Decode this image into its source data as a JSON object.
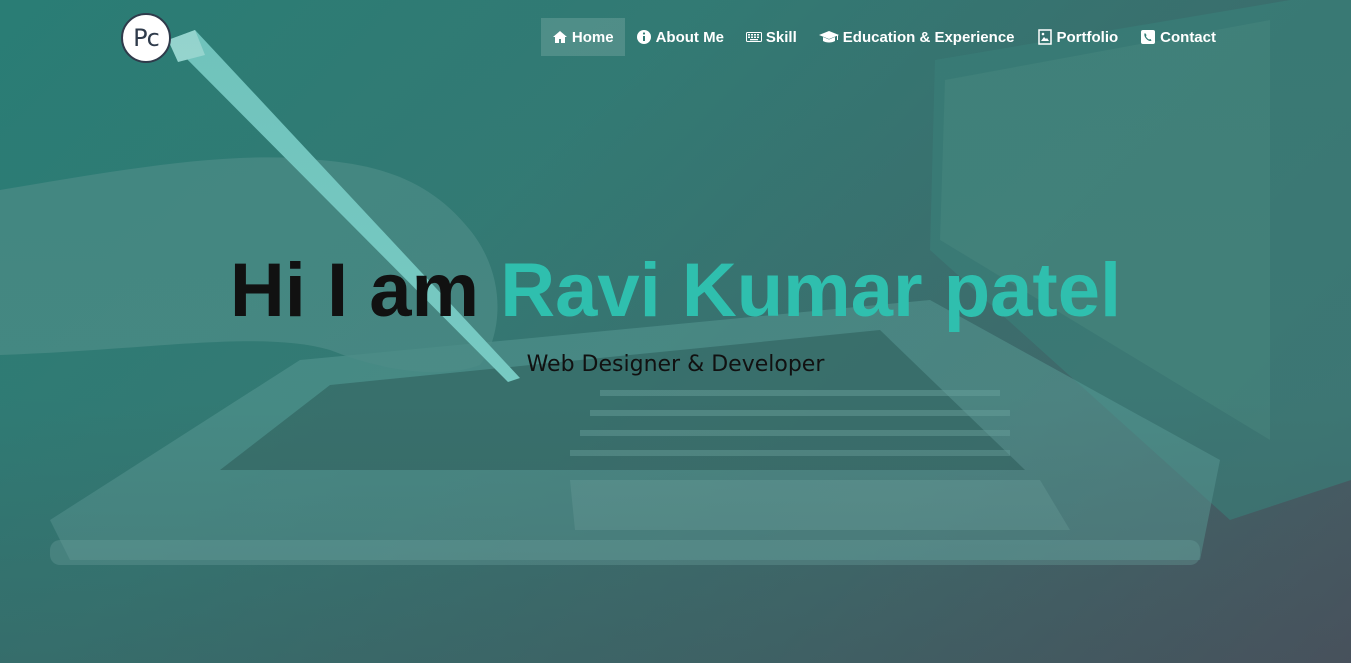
{
  "brand": {
    "logo_text": "Pc"
  },
  "nav": {
    "items": [
      {
        "label": "Home",
        "icon": "home-icon",
        "active": true
      },
      {
        "label": "About Me",
        "icon": "info-icon",
        "active": false
      },
      {
        "label": "Skill",
        "icon": "keyboard-icon",
        "active": false
      },
      {
        "label": "Education & Experience",
        "icon": "graduation-cap-icon",
        "active": false
      },
      {
        "label": "Portfolio",
        "icon": "image-icon",
        "active": false
      },
      {
        "label": "Contact",
        "icon": "phone-icon",
        "active": false
      }
    ]
  },
  "hero": {
    "greeting": "Hi I am",
    "name": "Ravi Kumar patel",
    "subtitle": "Web Designer & Developer"
  },
  "colors": {
    "accent": "#2fbfae",
    "overlay": "#2a7e76",
    "text_dark": "#111111",
    "nav_text": "#ffffff"
  }
}
